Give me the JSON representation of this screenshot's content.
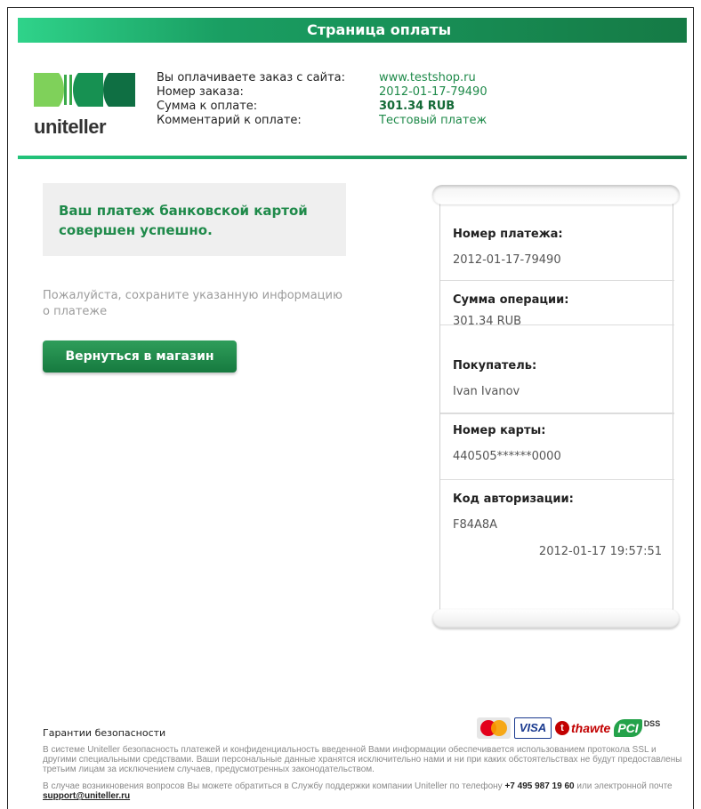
{
  "header": {
    "title": "Страница оплаты"
  },
  "brand": {
    "name": "uniteller",
    "colors": {
      "green_light": "#2fd38a",
      "green_dark": "#146a37",
      "text_green": "#1f8a4a"
    }
  },
  "order": {
    "labels": {
      "site": "Вы оплачиваете заказ с сайта:",
      "number": "Номер заказа:",
      "amount": "Сумма к оплате:",
      "comment": "Комментарий к оплате:"
    },
    "values": {
      "site": "www.testshop.ru",
      "number": "2012-01-17-79490",
      "amount": "301.34 RUB",
      "comment": "Тестовый платеж"
    }
  },
  "status": {
    "message": "Ваш платеж банковской картой совершен успешно.",
    "save_note": "Пожалуйста, сохраните указанную информацию о платеже",
    "return_button": "Вернуться в магазин"
  },
  "receipt": {
    "fields": [
      {
        "label": "Номер платежа:",
        "value": "2012-01-17-79490"
      },
      {
        "label": "Сумма операции:",
        "value": "301.34 RUB"
      },
      {
        "label": "Покупатель:",
        "value": "Ivan Ivanov"
      },
      {
        "label": "Номер карты:",
        "value": "440505******0000"
      },
      {
        "label": "Код авторизации:",
        "value": "F84A8A"
      }
    ],
    "timestamp": "2012-01-17 19:57:51"
  },
  "footer": {
    "security_title": "Гарантии безопасности",
    "security_text": "В системе Uniteller безопасность платежей и конфиденциальность введенной Вами информации обеспечивается использованием протокола SSL и другими специальными средствами. Ваши персональные данные хранятся исключительно нами и ни при каких обстоятельствах не будут предоставлены третьим лицам за исключением случаев, предусмотренных законодательством.",
    "support_prefix": "В случае возникновения вопросов Вы можете обратиться в Службу поддержки компании Uniteller по телефону",
    "support_phone": "+7 495 987 19 60",
    "support_middle": "или электронной почте",
    "support_email": "support@uniteller.ru",
    "badges": {
      "mastercard": "MasterCard",
      "visa": "VISA",
      "thawte": "thawte",
      "pci": "PCI",
      "dss": "DSS"
    },
    "icons": [
      "mastercard-logo-icon",
      "visa-logo-icon",
      "thawte-logo-icon",
      "pci-dss-logo-icon"
    ]
  }
}
